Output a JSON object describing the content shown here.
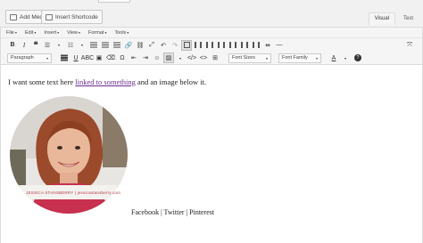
{
  "media_buttons": {
    "add_media": "Add Media",
    "add_shortcode": "Insert Shortcode"
  },
  "tabs": [
    "Visual",
    "Text"
  ],
  "menubar": [
    "File",
    "Edit",
    "Insert",
    "View",
    "Format",
    "Tools"
  ],
  "toolbar": {
    "format_select": "Paragraph",
    "font_sizes": "Font Sizes",
    "font_family": "Font Family",
    "text_color_letter": "A",
    "help_symbol": "?"
  },
  "content": {
    "text_before": "I want some text here ",
    "link_text": "linked to something",
    "text_after": " and an image below it.",
    "image_caption": "JESSICA STANSBERRY  |  jessicastansberry.com",
    "social_line": "Facebook | Twitter | Pinterest"
  },
  "colors": {
    "link": "#6b2c8f",
    "caption": "#b23a4a"
  }
}
